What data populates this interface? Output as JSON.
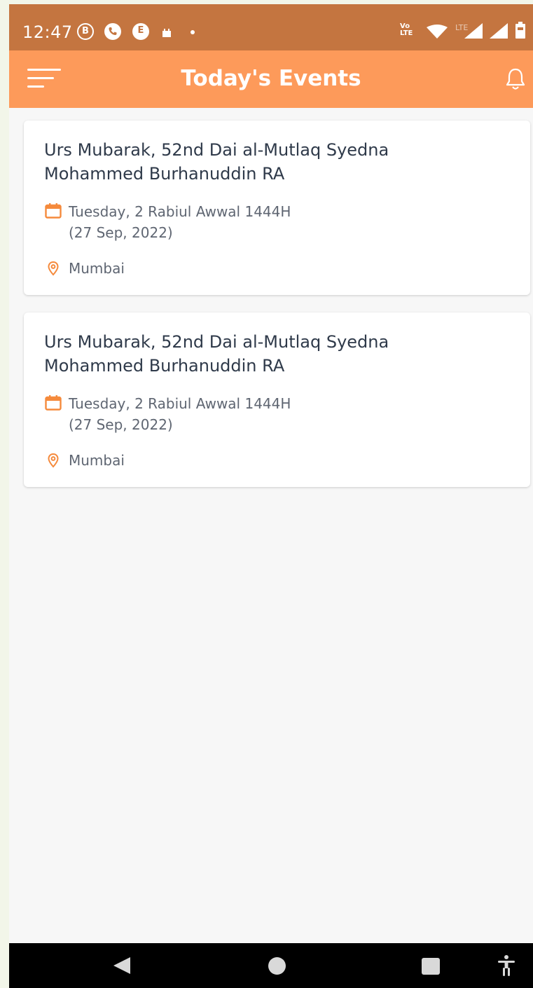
{
  "status_bar": {
    "time": "12:47",
    "left_icons": [
      "b-circle-icon",
      "phone-circle-icon",
      "e-circle-icon",
      "sim-icon",
      "dot-icon"
    ],
    "right_icons": [
      "volte-icon",
      "wifi-icon",
      "lte-signal-icon",
      "signal-icon",
      "battery-icon"
    ],
    "volte_label_top": "Vo",
    "volte_label_bottom": "LTE",
    "lte_label": "LTE",
    "b_letter": "B",
    "e_letter": "E"
  },
  "app_bar": {
    "title": "Today's Events",
    "left_icon": "menu-icon",
    "right_icon": "bell-icon"
  },
  "events": [
    {
      "title": "Urs Mubarak, 52nd Dai al-Mutlaq Syedna Mohammed Burhanuddin RA",
      "date_line1": "Tuesday, 2 Rabiul Awwal 1444H",
      "date_line2": "(27 Sep, 2022)",
      "location": "Mumbai"
    },
    {
      "title": "Urs Mubarak, 52nd Dai al-Mutlaq Syedna Mohammed Burhanuddin RA",
      "date_line1": "Tuesday, 2 Rabiul Awwal 1444H",
      "date_line2": "(27 Sep, 2022)",
      "location": "Mumbai"
    }
  ],
  "nav_bar": {
    "buttons": [
      "back-icon",
      "home-icon",
      "recents-icon",
      "accessibility-icon"
    ]
  },
  "colors": {
    "status_bar": "#c47540",
    "app_bar": "#fd9a5a",
    "accent": "#f58a3c",
    "background": "#f7f7f7",
    "card": "#ffffff",
    "title_text": "#2f3a4a",
    "secondary_text": "#5f6672"
  }
}
